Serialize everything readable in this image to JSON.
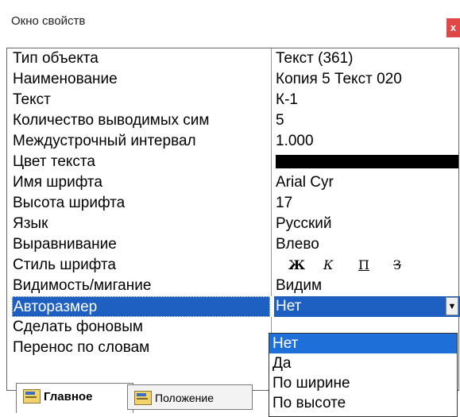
{
  "window": {
    "title": "Окно свойств",
    "close_label": "x"
  },
  "properties": [
    {
      "name": "Тип объекта",
      "value": "Текст (361)"
    },
    {
      "name": "Наименование",
      "value": "Копия 5 Текст 020"
    },
    {
      "name": "Текст",
      "value": "К-1"
    },
    {
      "name": "Количество выводимых сим",
      "value": "5"
    },
    {
      "name": "Междустрочный интервал",
      "value": "1.000"
    },
    {
      "name": "Цвет текста",
      "value_color": "#000000"
    },
    {
      "name": "Имя шрифта",
      "value": "Arial Cyr"
    },
    {
      "name": "Высота шрифта",
      "value": "17"
    },
    {
      "name": "Язык",
      "value": "Русский"
    },
    {
      "name": "Выравнивание",
      "value": "Влево"
    },
    {
      "name": "Стиль шрифта",
      "styles": [
        "Ж",
        "К",
        "П",
        "З"
      ]
    },
    {
      "name": "Видимость/мигание",
      "value": "Видим"
    },
    {
      "name": "Авторазмер",
      "value": "Нет",
      "selected": true
    },
    {
      "name": "Сделать фоновым",
      "value": ""
    },
    {
      "name": "Перенос по словам",
      "value": ""
    }
  ],
  "dropdown": {
    "arrow_icon": "dropdown-arrow-icon",
    "options": [
      "Нет",
      "Да",
      "По ширине",
      "По высоте"
    ],
    "selected_index": 0
  },
  "tabs": [
    {
      "label": "Главное",
      "active": true,
      "icon": "properties-icon"
    },
    {
      "label": "Положение",
      "active": false,
      "icon": "properties-icon"
    }
  ],
  "colors": {
    "selection": "#1e5fc2",
    "close_button": "#e04848"
  }
}
